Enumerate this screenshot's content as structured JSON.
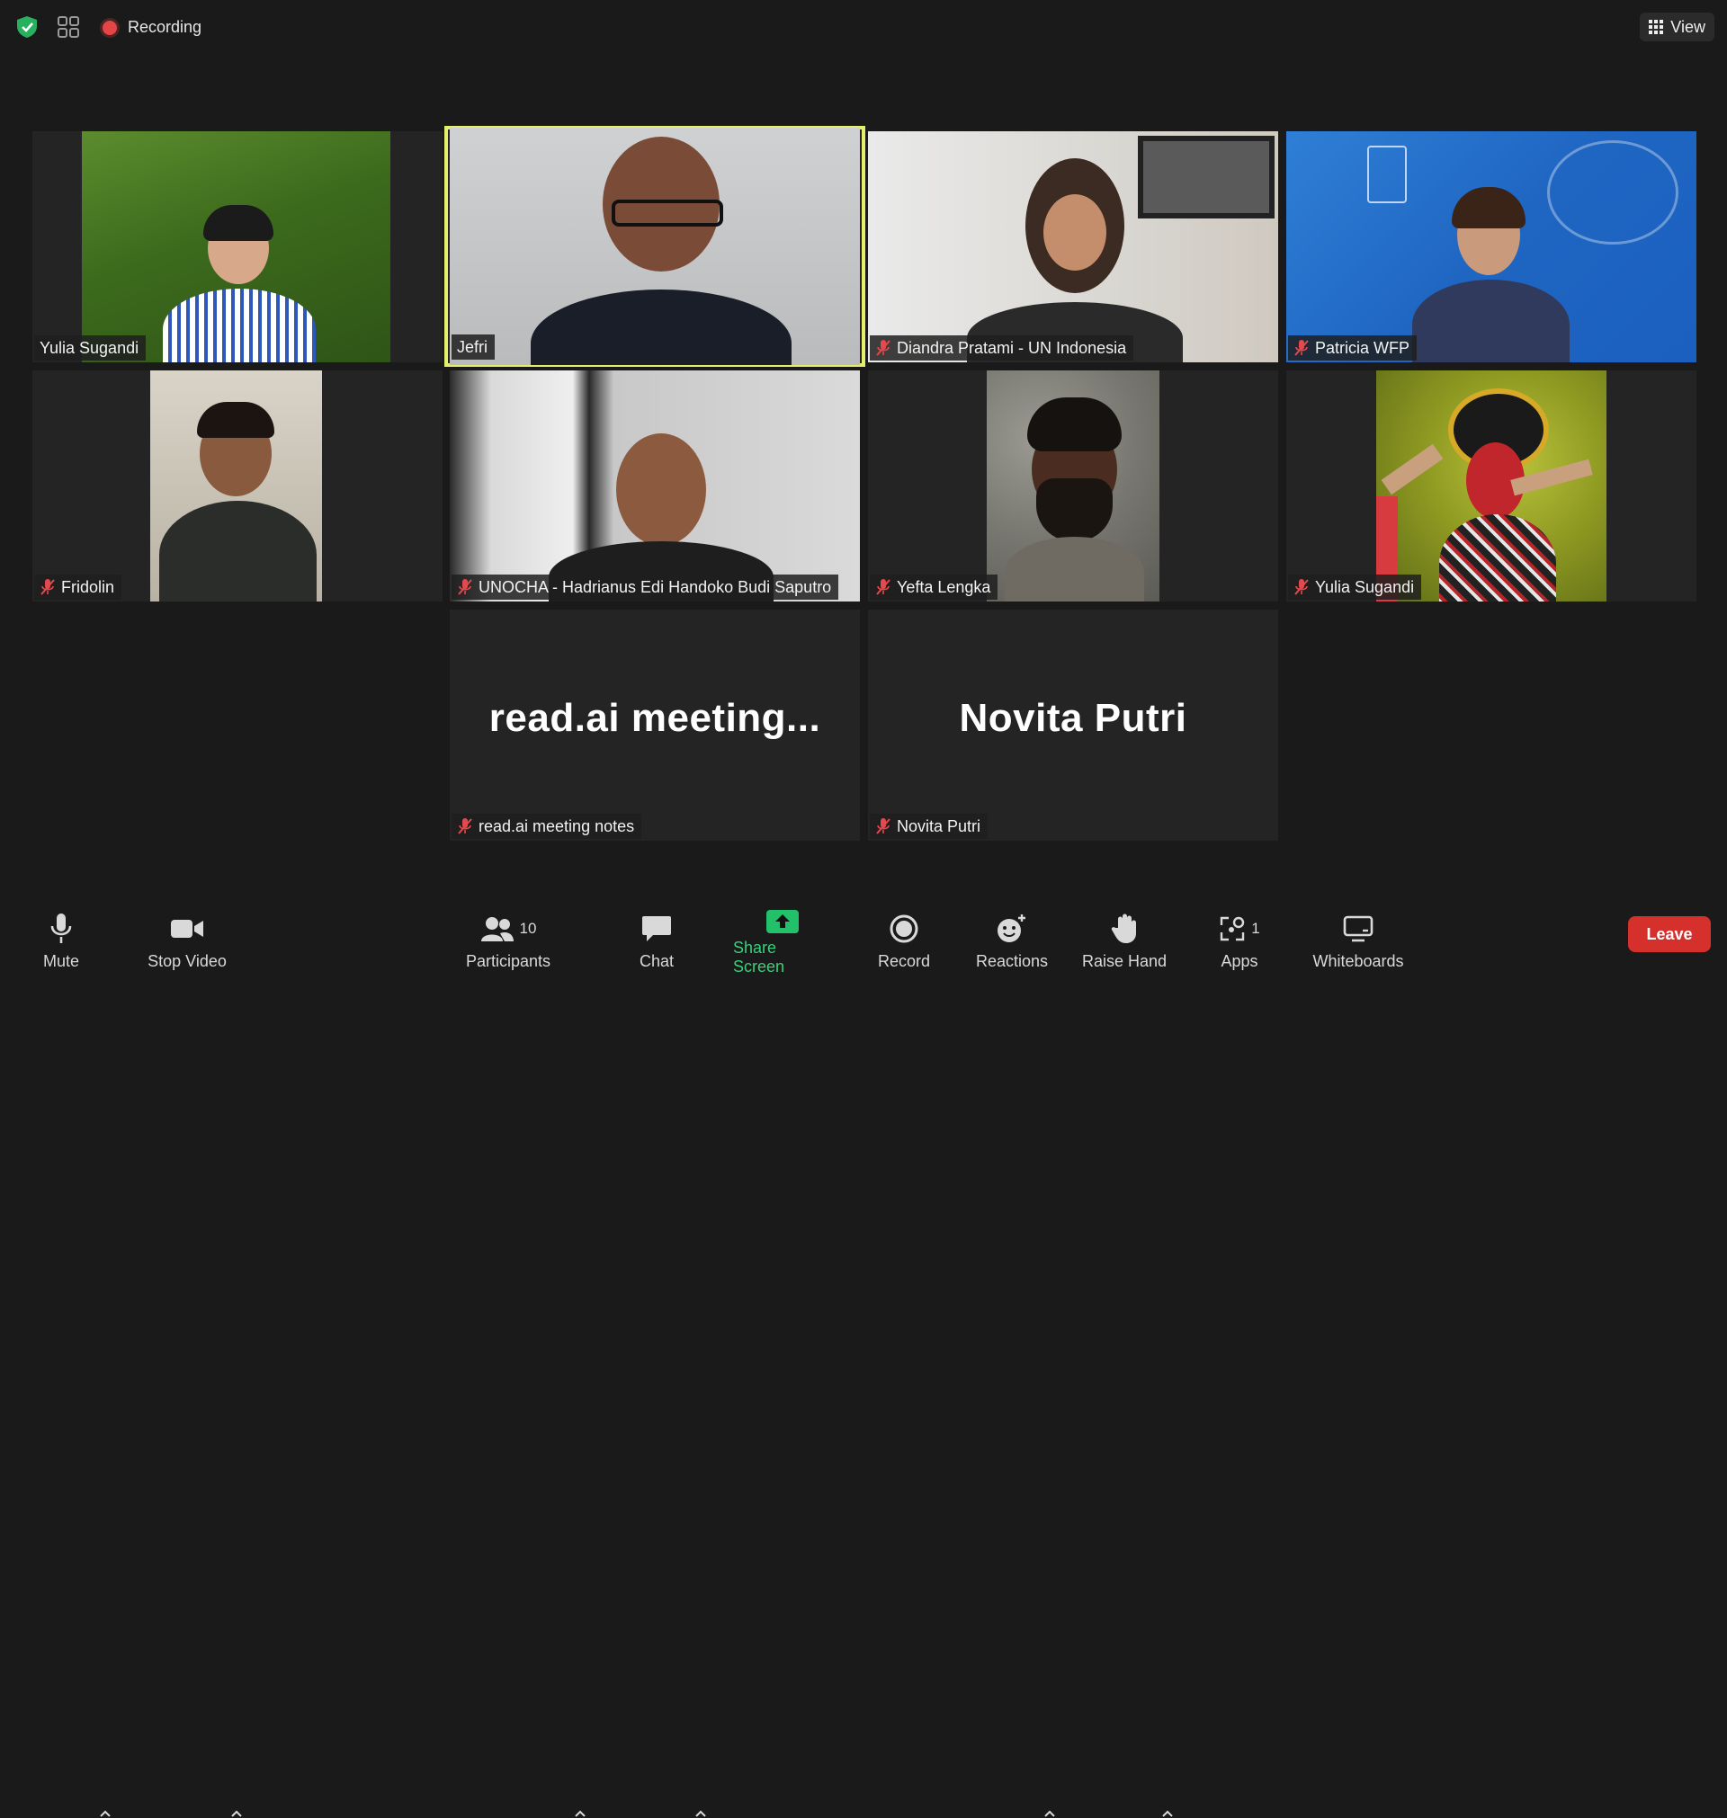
{
  "top_bar": {
    "recording_label": "Recording",
    "view_label": "View"
  },
  "tiles": [
    {
      "name": "Yulia Sugandi",
      "muted": false
    },
    {
      "name": "Jefri",
      "muted": false,
      "active_speaker": true
    },
    {
      "name": "Diandra Pratami - UN Indonesia",
      "muted": true
    },
    {
      "name": "Patricia WFP",
      "muted": true
    },
    {
      "name": "Fridolin",
      "muted": true
    },
    {
      "name": "UNOCHA - Hadrianus Edi Handoko Budi Saputro",
      "muted": true
    },
    {
      "name": "Yefta Lengka",
      "muted": true
    },
    {
      "name": "Yulia Sugandi",
      "muted": true
    },
    {
      "name": "read.ai meeting notes",
      "display_text": "read.ai  meeting...",
      "muted": true
    },
    {
      "name": "Novita Putri",
      "display_text": "Novita Putri",
      "muted": true
    }
  ],
  "toolbar": {
    "mute": "Mute",
    "stop_video": "Stop Video",
    "participants": "Participants",
    "participants_count": "10",
    "chat": "Chat",
    "share_screen": "Share Screen",
    "record": "Record",
    "reactions": "Reactions",
    "raise_hand": "Raise Hand",
    "apps": "Apps",
    "apps_count": "1",
    "whiteboards": "Whiteboards",
    "leave": "Leave"
  },
  "colors": {
    "background": "#1a1a1a",
    "tile": "#242424",
    "active_speaker_border": "#e5ef6b",
    "share_green": "#23c06a",
    "leave_red": "#d6302c",
    "muted_red": "#e5484d"
  }
}
